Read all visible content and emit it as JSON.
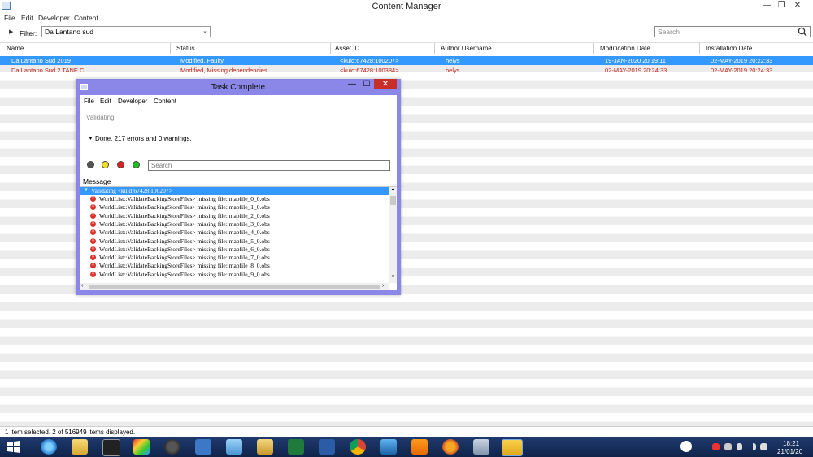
{
  "window": {
    "title": "Content Manager",
    "minimize": "—",
    "maximize": "❐",
    "close": "✕"
  },
  "menu": [
    "File",
    "Edit",
    "Developer",
    "Content"
  ],
  "toolbar": {
    "filter_label": "Filter:",
    "filter_value": "Da Lantano sud",
    "search_placeholder": "Search"
  },
  "grid": {
    "columns": [
      "Name",
      "Status",
      "Asset ID",
      "Author Username",
      "Modification Date",
      "Installation Date"
    ],
    "rows": [
      {
        "name": "Da Lantano Sud 2019",
        "status": "Modified, Faulty",
        "asset_id": "<kuid:67428:100207>",
        "author": "helys",
        "modified": "19-JAN-2020 20:19:11",
        "installed": "02-MAY-2019 20:22:33",
        "state": "selected"
      },
      {
        "name": "Da Lantano Sud 2 TANE C",
        "status": "Modified, Missing dependencies",
        "asset_id": "<kuid:67428:100384>",
        "author": "helys",
        "modified": "02-MAY-2019 20:24:33",
        "installed": "02-MAY-2019 20:24:33",
        "state": "error"
      }
    ]
  },
  "status_bar": "1 item selected. 2 of 516949 items displayed.",
  "dialog": {
    "title": "Task Complete",
    "minimize": "—",
    "maximize": "☐",
    "close": "✕",
    "menu": [
      "File",
      "Edit",
      "Developer",
      "Content"
    ],
    "validating_label": "Validating",
    "done_text": "Done. 217 errors and 0 warnings.",
    "filter_dot_colors": [
      "#555555",
      "#f0e020",
      "#e02020",
      "#20c020"
    ],
    "search_placeholder": "Search",
    "message_header": "Message",
    "tree_header": "Validating <kuid:67428:100207>",
    "messages": [
      "WorldList::ValidateBackingStoreFiles> missing file: mapfile_0_0.obs",
      "WorldList::ValidateBackingStoreFiles> missing file: mapfile_1_0.obs",
      "WorldList::ValidateBackingStoreFiles> missing file: mapfile_2_0.obs",
      "WorldList::ValidateBackingStoreFiles> missing file: mapfile_3_0.obs",
      "WorldList::ValidateBackingStoreFiles> missing file: mapfile_4_0.obs",
      "WorldList::ValidateBackingStoreFiles> missing file: mapfile_5_0.obs",
      "WorldList::ValidateBackingStoreFiles> missing file: mapfile_6_0.obs",
      "WorldList::ValidateBackingStoreFiles> missing file: mapfile_7_0.obs",
      "WorldList::ValidateBackingStoreFiles> missing file: mapfile_8_0.obs",
      "WorldList::ValidateBackingStoreFiles> missing file: mapfile_9_0.obs"
    ]
  },
  "taskbar": {
    "apps": [
      "windows-start",
      "internet-explorer",
      "file-explorer",
      "camera-app",
      "paint-app",
      "hp-app",
      "remote-app",
      "notes-app",
      "folder-app",
      "excel-app",
      "word-app",
      "chrome-app",
      "trainz-app",
      "vlc-app",
      "firefox-app",
      "tool-app",
      "content-manager-app"
    ],
    "clock_time": "18:21",
    "clock_date": "21/01/20"
  }
}
